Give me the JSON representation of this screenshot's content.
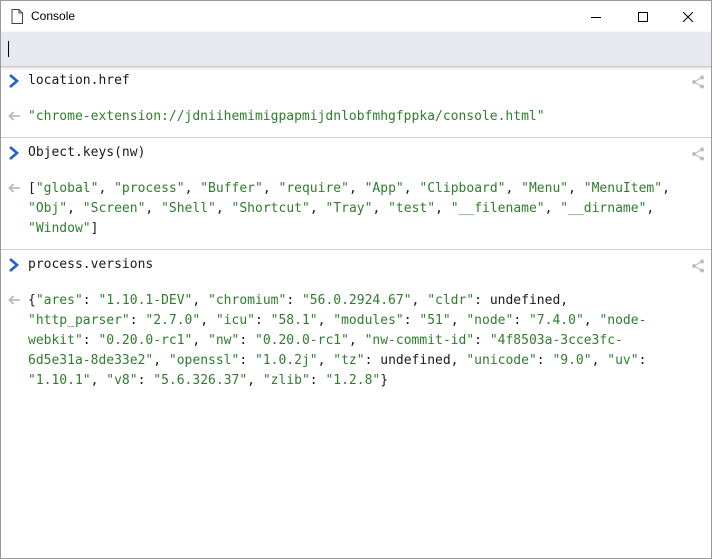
{
  "window": {
    "title": "Console",
    "minimize_glyph": "—",
    "maximize_glyph": "☐",
    "close_glyph": "✕"
  },
  "input": {
    "value": "",
    "placeholder": ""
  },
  "icons": {
    "title_icon": "document-icon",
    "prompt_icon": "chevron-right-icon",
    "return_icon": "return-arrow-icon",
    "share_icon": "share-icon"
  },
  "colors": {
    "prompt_blue": "#1f5fd6",
    "string_green": "#2f7d2d",
    "input_bar_bg": "#e8e9ee",
    "icon_gray": "#b8b8b8"
  },
  "entries": [
    {
      "command": "location.href",
      "result_tokens": [
        {
          "text": "\"chrome-extension://jdniihemimigpapmijdnlobfmhgfppka/console.html\"",
          "kind": "str"
        }
      ]
    },
    {
      "command": "Object.keys(nw)",
      "result_tokens": [
        {
          "text": "[",
          "kind": "plain"
        },
        {
          "text": "\"global\"",
          "kind": "str"
        },
        {
          "text": ", ",
          "kind": "plain"
        },
        {
          "text": "\"process\"",
          "kind": "str"
        },
        {
          "text": ", ",
          "kind": "plain"
        },
        {
          "text": "\"Buffer\"",
          "kind": "str"
        },
        {
          "text": ", ",
          "kind": "plain"
        },
        {
          "text": "\"require\"",
          "kind": "str"
        },
        {
          "text": ", ",
          "kind": "plain"
        },
        {
          "text": "\"App\"",
          "kind": "str"
        },
        {
          "text": ", ",
          "kind": "plain"
        },
        {
          "text": "\"Clipboard\"",
          "kind": "str"
        },
        {
          "text": ", ",
          "kind": "plain"
        },
        {
          "text": "\"Menu\"",
          "kind": "str"
        },
        {
          "text": ", ",
          "kind": "plain"
        },
        {
          "text": "\"MenuItem\"",
          "kind": "str"
        },
        {
          "text": ",\n",
          "kind": "plain"
        },
        {
          "text": "\"Obj\"",
          "kind": "str"
        },
        {
          "text": ", ",
          "kind": "plain"
        },
        {
          "text": "\"Screen\"",
          "kind": "str"
        },
        {
          "text": ", ",
          "kind": "plain"
        },
        {
          "text": "\"Shell\"",
          "kind": "str"
        },
        {
          "text": ", ",
          "kind": "plain"
        },
        {
          "text": "\"Shortcut\"",
          "kind": "str"
        },
        {
          "text": ", ",
          "kind": "plain"
        },
        {
          "text": "\"Tray\"",
          "kind": "str"
        },
        {
          "text": ", ",
          "kind": "plain"
        },
        {
          "text": "\"test\"",
          "kind": "str"
        },
        {
          "text": ", ",
          "kind": "plain"
        },
        {
          "text": "\"__filename\"",
          "kind": "str"
        },
        {
          "text": ", ",
          "kind": "plain"
        },
        {
          "text": "\"__dirname\"",
          "kind": "str"
        },
        {
          "text": ",\n",
          "kind": "plain"
        },
        {
          "text": "\"Window\"",
          "kind": "str"
        },
        {
          "text": "]",
          "kind": "plain"
        }
      ]
    },
    {
      "command": "process.versions",
      "result_tokens": [
        {
          "text": "{",
          "kind": "plain"
        },
        {
          "text": "\"ares\"",
          "kind": "str"
        },
        {
          "text": ": ",
          "kind": "plain"
        },
        {
          "text": "\"1.10.1-DEV\"",
          "kind": "str"
        },
        {
          "text": ", ",
          "kind": "plain"
        },
        {
          "text": "\"chromium\"",
          "kind": "str"
        },
        {
          "text": ": ",
          "kind": "plain"
        },
        {
          "text": "\"56.0.2924.67\"",
          "kind": "str"
        },
        {
          "text": ", ",
          "kind": "plain"
        },
        {
          "text": "\"cldr\"",
          "kind": "str"
        },
        {
          "text": ": undefined,\n",
          "kind": "plain"
        },
        {
          "text": "\"http_parser\"",
          "kind": "str"
        },
        {
          "text": ": ",
          "kind": "plain"
        },
        {
          "text": "\"2.7.0\"",
          "kind": "str"
        },
        {
          "text": ", ",
          "kind": "plain"
        },
        {
          "text": "\"icu\"",
          "kind": "str"
        },
        {
          "text": ": ",
          "kind": "plain"
        },
        {
          "text": "\"58.1\"",
          "kind": "str"
        },
        {
          "text": ", ",
          "kind": "plain"
        },
        {
          "text": "\"modules\"",
          "kind": "str"
        },
        {
          "text": ": ",
          "kind": "plain"
        },
        {
          "text": "\"51\"",
          "kind": "str"
        },
        {
          "text": ", ",
          "kind": "plain"
        },
        {
          "text": "\"node\"",
          "kind": "str"
        },
        {
          "text": ": ",
          "kind": "plain"
        },
        {
          "text": "\"7.4.0\"",
          "kind": "str"
        },
        {
          "text": ", ",
          "kind": "plain"
        },
        {
          "text": "\"node-\nwebkit\"",
          "kind": "str"
        },
        {
          "text": ": ",
          "kind": "plain"
        },
        {
          "text": "\"0.20.0-rc1\"",
          "kind": "str"
        },
        {
          "text": ", ",
          "kind": "plain"
        },
        {
          "text": "\"nw\"",
          "kind": "str"
        },
        {
          "text": ": ",
          "kind": "plain"
        },
        {
          "text": "\"0.20.0-rc1\"",
          "kind": "str"
        },
        {
          "text": ", ",
          "kind": "plain"
        },
        {
          "text": "\"nw-commit-id\"",
          "kind": "str"
        },
        {
          "text": ": ",
          "kind": "plain"
        },
        {
          "text": "\"4f8503a-3cce3fc-\n6d5e31a-8de33e2\"",
          "kind": "str"
        },
        {
          "text": ", ",
          "kind": "plain"
        },
        {
          "text": "\"openssl\"",
          "kind": "str"
        },
        {
          "text": ": ",
          "kind": "plain"
        },
        {
          "text": "\"1.0.2j\"",
          "kind": "str"
        },
        {
          "text": ", ",
          "kind": "plain"
        },
        {
          "text": "\"tz\"",
          "kind": "str"
        },
        {
          "text": ": undefined, ",
          "kind": "plain"
        },
        {
          "text": "\"unicode\"",
          "kind": "str"
        },
        {
          "text": ": ",
          "kind": "plain"
        },
        {
          "text": "\"9.0\"",
          "kind": "str"
        },
        {
          "text": ", ",
          "kind": "plain"
        },
        {
          "text": "\"uv\"",
          "kind": "str"
        },
        {
          "text": ":\n",
          "kind": "plain"
        },
        {
          "text": "\"1.10.1\"",
          "kind": "str"
        },
        {
          "text": ", ",
          "kind": "plain"
        },
        {
          "text": "\"v8\"",
          "kind": "str"
        },
        {
          "text": ": ",
          "kind": "plain"
        },
        {
          "text": "\"5.6.326.37\"",
          "kind": "str"
        },
        {
          "text": ", ",
          "kind": "plain"
        },
        {
          "text": "\"zlib\"",
          "kind": "str"
        },
        {
          "text": ": ",
          "kind": "plain"
        },
        {
          "text": "\"1.2.8\"",
          "kind": "str"
        },
        {
          "text": "}",
          "kind": "plain"
        }
      ]
    }
  ]
}
